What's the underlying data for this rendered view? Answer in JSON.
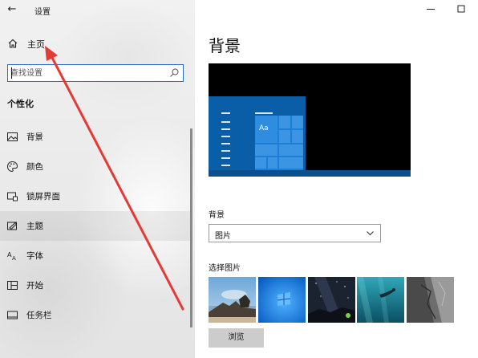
{
  "window": {
    "title": "设置",
    "back_icon": "←",
    "minimize_icon": "minimize-icon",
    "maximize_icon": "maximize-icon"
  },
  "sidebar": {
    "home_label": "主页",
    "search": {
      "placeholder": "查找设置",
      "value": ""
    },
    "section_title": "个性化",
    "items": [
      {
        "label": "背景",
        "icon": "picture-icon",
        "selected": false
      },
      {
        "label": "颜色",
        "icon": "palette-icon",
        "selected": false
      },
      {
        "label": "锁屏界面",
        "icon": "lock-screen-icon",
        "selected": false
      },
      {
        "label": "主题",
        "icon": "theme-brush-icon",
        "selected": true
      },
      {
        "label": "字体",
        "icon": "font-icon",
        "selected": false
      },
      {
        "label": "开始",
        "icon": "start-menu-icon",
        "selected": false
      },
      {
        "label": "任务栏",
        "icon": "taskbar-icon",
        "selected": false
      }
    ]
  },
  "main": {
    "title": "背景",
    "preview_tile_text": "Aa",
    "background_label": "背景",
    "background_value": "图片",
    "choose_picture_label": "选择图片",
    "thumbnails": [
      "beach-rocks",
      "windows-blue",
      "night-sky",
      "underwater-swimmer",
      "rock-cliff"
    ],
    "browse_label": "浏览"
  },
  "colors": {
    "accent": "#0063b1",
    "annotation_red": "#e53935",
    "selected_item_bg": "#e1e1e1"
  }
}
